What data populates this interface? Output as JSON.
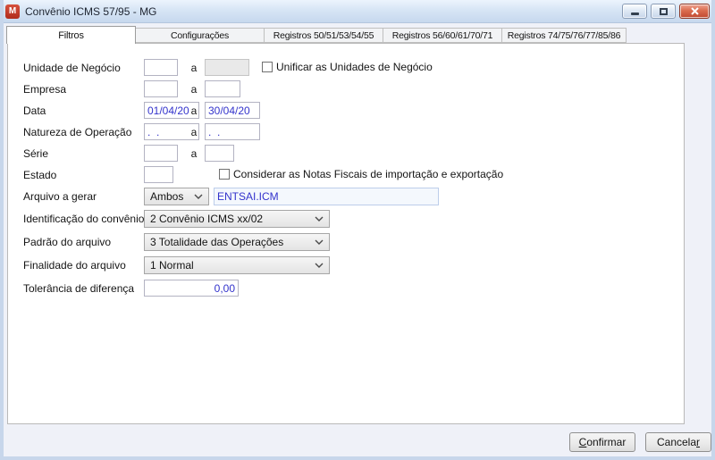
{
  "window": {
    "title": "Convênio ICMS 57/95 - MG",
    "icon_letter": "M"
  },
  "colors": {
    "titlebar_blue": "#c6d8ee",
    "close_button_red": "#c04a30",
    "input_text_blue": "#3333cc",
    "app_icon_red": "#b02c1c"
  },
  "tabs": [
    {
      "label": "Filtros",
      "active": true
    },
    {
      "label": "Configurações",
      "active": false
    },
    {
      "label": "Registros 50/51/53/54/55",
      "active": false
    },
    {
      "label": "Registros 56/60/61/70/71",
      "active": false
    },
    {
      "label": "Registros 74/75/76/77/85/86",
      "active": false
    }
  ],
  "form": {
    "range_separator": "a",
    "unidade_negocio": {
      "label": "Unidade de Negócio",
      "from": "",
      "to": ""
    },
    "unificar": {
      "label": "Unificar as Unidades de Negócio",
      "checked": false
    },
    "empresa": {
      "label": "Empresa",
      "from": "",
      "to": ""
    },
    "data": {
      "label": "Data",
      "from": "01/04/20",
      "to": "30/04/20"
    },
    "natureza": {
      "label": "Natureza de Operação",
      "from": ".  .",
      "to": ".  ."
    },
    "serie": {
      "label": "Série",
      "from": "",
      "to": ""
    },
    "estado": {
      "label": "Estado",
      "value": ""
    },
    "considerar": {
      "label": "Considerar as Notas Fiscais de importação e exportação",
      "checked": false
    },
    "arquivo_gerar": {
      "label": "Arquivo a gerar",
      "value": "Ambos",
      "filename": "ENTSAI.ICM"
    },
    "identificacao": {
      "label": "Identificação do convênio",
      "value": "2 Convênio ICMS xx/02"
    },
    "padrao": {
      "label": "Padrão do arquivo",
      "value": "3 Totalidade das Operações"
    },
    "finalidade": {
      "label": "Finalidade do arquivo",
      "value": "1 Normal"
    },
    "tolerancia": {
      "label": "Tolerância de diferença",
      "value": "0,00"
    }
  },
  "footer": {
    "confirm_mnemonic": "C",
    "confirm_rest": "onfirmar",
    "cancel_pre": "Cancela",
    "cancel_mnemonic": "r"
  }
}
